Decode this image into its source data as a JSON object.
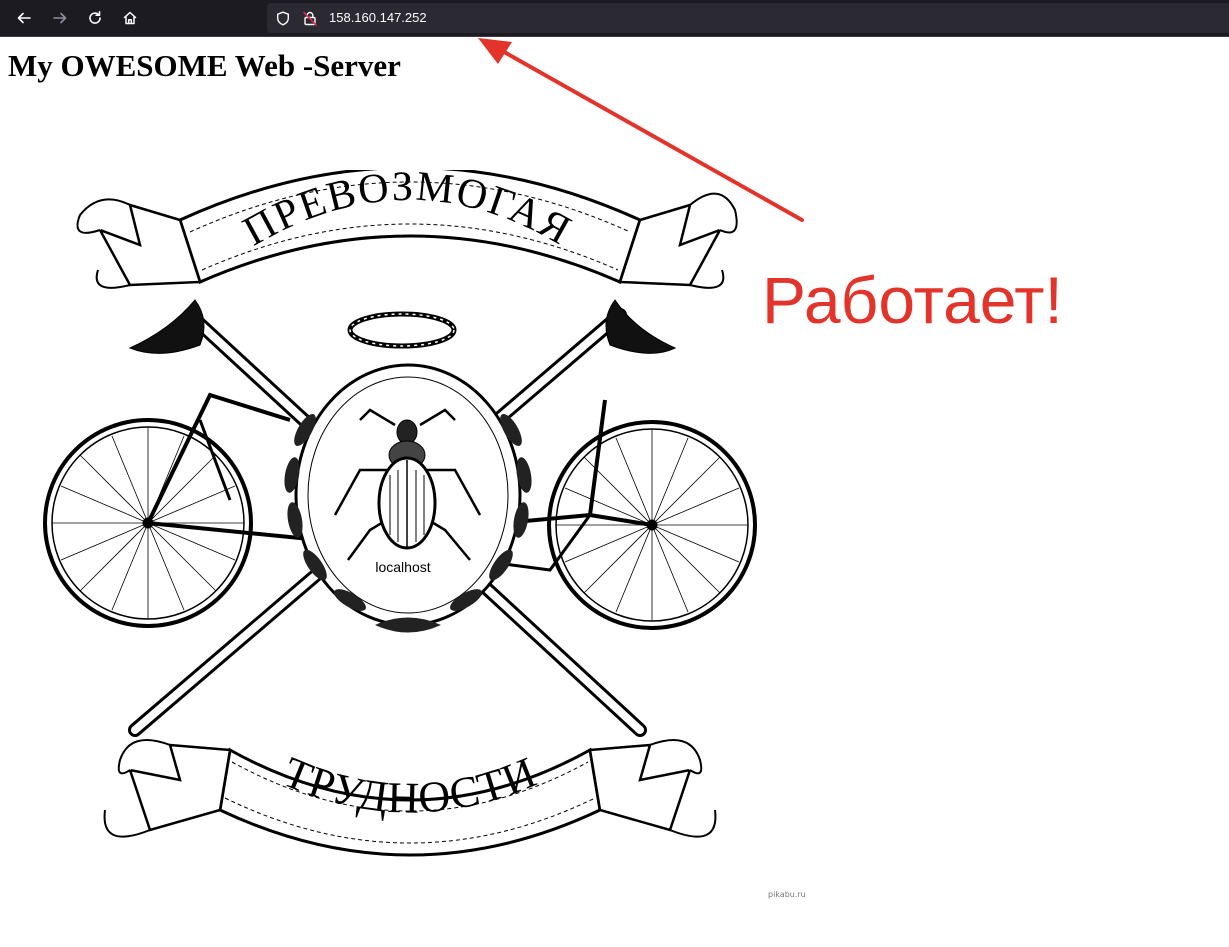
{
  "browser": {
    "url": "158.160.147.252",
    "icons": [
      "back-arrow-icon",
      "forward-arrow-icon",
      "reload-icon",
      "home-icon",
      "shield-icon",
      "insecure-lock-icon"
    ],
    "toolbar_color": "#1c1b22",
    "urlbar_color": "#2b2a33"
  },
  "page": {
    "title": "My OWESOME Web -Server"
  },
  "emblem": {
    "banner_top": "ПРЕВОЗМОГАЯ",
    "banner_bottom": "ТРУДНОСТИ",
    "center_label": "localhost"
  },
  "annotation": {
    "text": "Работает!",
    "color": "#e2342a"
  },
  "watermark": "pikabu.ru"
}
